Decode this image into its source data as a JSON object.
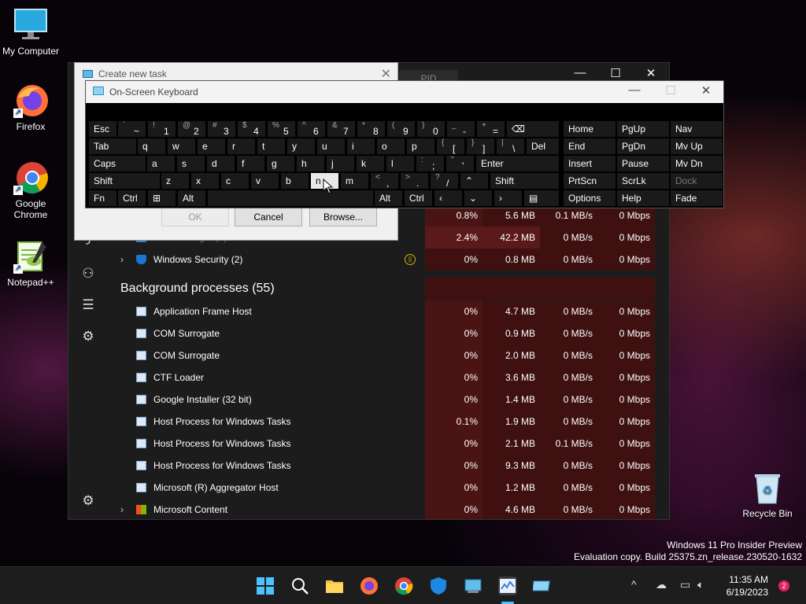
{
  "desktop": {
    "icons": [
      {
        "label": "My Computer",
        "icon": "monitor-icon"
      },
      {
        "label": "Firefox",
        "icon": "firefox-icon"
      },
      {
        "label": "Google Chrome",
        "icon": "chrome-icon"
      },
      {
        "label": "Notepad++",
        "icon": "notepadpp-icon"
      },
      {
        "label": "Recycle Bin",
        "icon": "recycle-bin-icon"
      }
    ],
    "watermark_line1": "Windows 11 Pro Insider Preview",
    "watermark_line2": "Evaluation copy. Build 25375.zn_release.230520-1632"
  },
  "task_manager": {
    "header_pid": "PID",
    "background_section": "Background processes (55)",
    "rows_top": [
      {
        "name": "",
        "cpu": "0.8%",
        "mem": "5.6 MB",
        "disk": "0.1 MB/s",
        "net": "0 Mbps"
      },
      {
        "name": "Task Manager (2)",
        "cpu": "2.4%",
        "mem": "42.2 MB",
        "disk": "0 MB/s",
        "net": "0 Mbps"
      },
      {
        "name": "Windows Security (2)",
        "cpu": "0%",
        "mem": "0.8 MB",
        "disk": "0 MB/s",
        "net": "0 Mbps"
      }
    ],
    "rows_bg": [
      {
        "name": "Application Frame Host",
        "cpu": "0%",
        "mem": "4.7 MB",
        "disk": "0 MB/s",
        "net": "0 Mbps"
      },
      {
        "name": "COM Surrogate",
        "cpu": "0%",
        "mem": "0.9 MB",
        "disk": "0 MB/s",
        "net": "0 Mbps"
      },
      {
        "name": "COM Surrogate",
        "cpu": "0%",
        "mem": "2.0 MB",
        "disk": "0 MB/s",
        "net": "0 Mbps"
      },
      {
        "name": "CTF Loader",
        "cpu": "0%",
        "mem": "3.6 MB",
        "disk": "0 MB/s",
        "net": "0 Mbps"
      },
      {
        "name": "Google Installer (32 bit)",
        "cpu": "0%",
        "mem": "1.4 MB",
        "disk": "0 MB/s",
        "net": "0 Mbps"
      },
      {
        "name": "Host Process for Windows Tasks",
        "cpu": "0.1%",
        "mem": "1.9 MB",
        "disk": "0 MB/s",
        "net": "0 Mbps"
      },
      {
        "name": "Host Process for Windows Tasks",
        "cpu": "0%",
        "mem": "2.1 MB",
        "disk": "0.1 MB/s",
        "net": "0 Mbps"
      },
      {
        "name": "Host Process for Windows Tasks",
        "cpu": "0%",
        "mem": "9.3 MB",
        "disk": "0 MB/s",
        "net": "0 Mbps"
      },
      {
        "name": "Microsoft (R) Aggregator Host",
        "cpu": "0%",
        "mem": "1.2 MB",
        "disk": "0 MB/s",
        "net": "0 Mbps"
      },
      {
        "name": "Microsoft Content",
        "cpu": "0%",
        "mem": "4.6 MB",
        "disk": "0 MB/s",
        "net": "0 Mbps"
      }
    ],
    "window_controls": {
      "minimize": "—",
      "maximize": "☐",
      "close": "✕"
    }
  },
  "run_dialog": {
    "title": "Create new task",
    "ok": "OK",
    "cancel": "Cancel",
    "browse": "Browse...",
    "close": "✕"
  },
  "osk": {
    "title": "On-Screen Keyboard",
    "controls": {
      "minimize": "—",
      "maximize": "☐",
      "close": "✕"
    }
  },
  "taskbar": {
    "time": "11:35 AM",
    "date": "6/19/2023",
    "notifications": "2",
    "chevron": "^"
  },
  "colors": {
    "accent": "#0078d4",
    "heat1": "#4a1414",
    "heat2": "#5a1a1a"
  }
}
